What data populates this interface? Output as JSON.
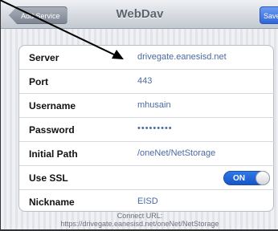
{
  "navbar": {
    "back_label": "Add Service",
    "title": "WebDav",
    "save_label": "Save"
  },
  "settings": {
    "rows": [
      {
        "label": "Server",
        "value": "drivegate.eanesisd.net"
      },
      {
        "label": "Port",
        "value": "443"
      },
      {
        "label": "Username",
        "value": "mhusain"
      },
      {
        "label": "Password",
        "value": "•••••••••"
      },
      {
        "label": "Initial Path",
        "value": "/oneNet/NetStorage"
      },
      {
        "label": "Use SSL",
        "toggle": "ON"
      },
      {
        "label": "Nickname",
        "value": "EISD"
      }
    ]
  },
  "footer": {
    "line1": "Connect URL:",
    "line2": "https://drivegate.eanesisd.net/oneNet/NetStorage"
  },
  "colors": {
    "value_text": "#4a6aa1",
    "toggle_on": "#2f78e8",
    "save_button": "#2f65d9"
  }
}
